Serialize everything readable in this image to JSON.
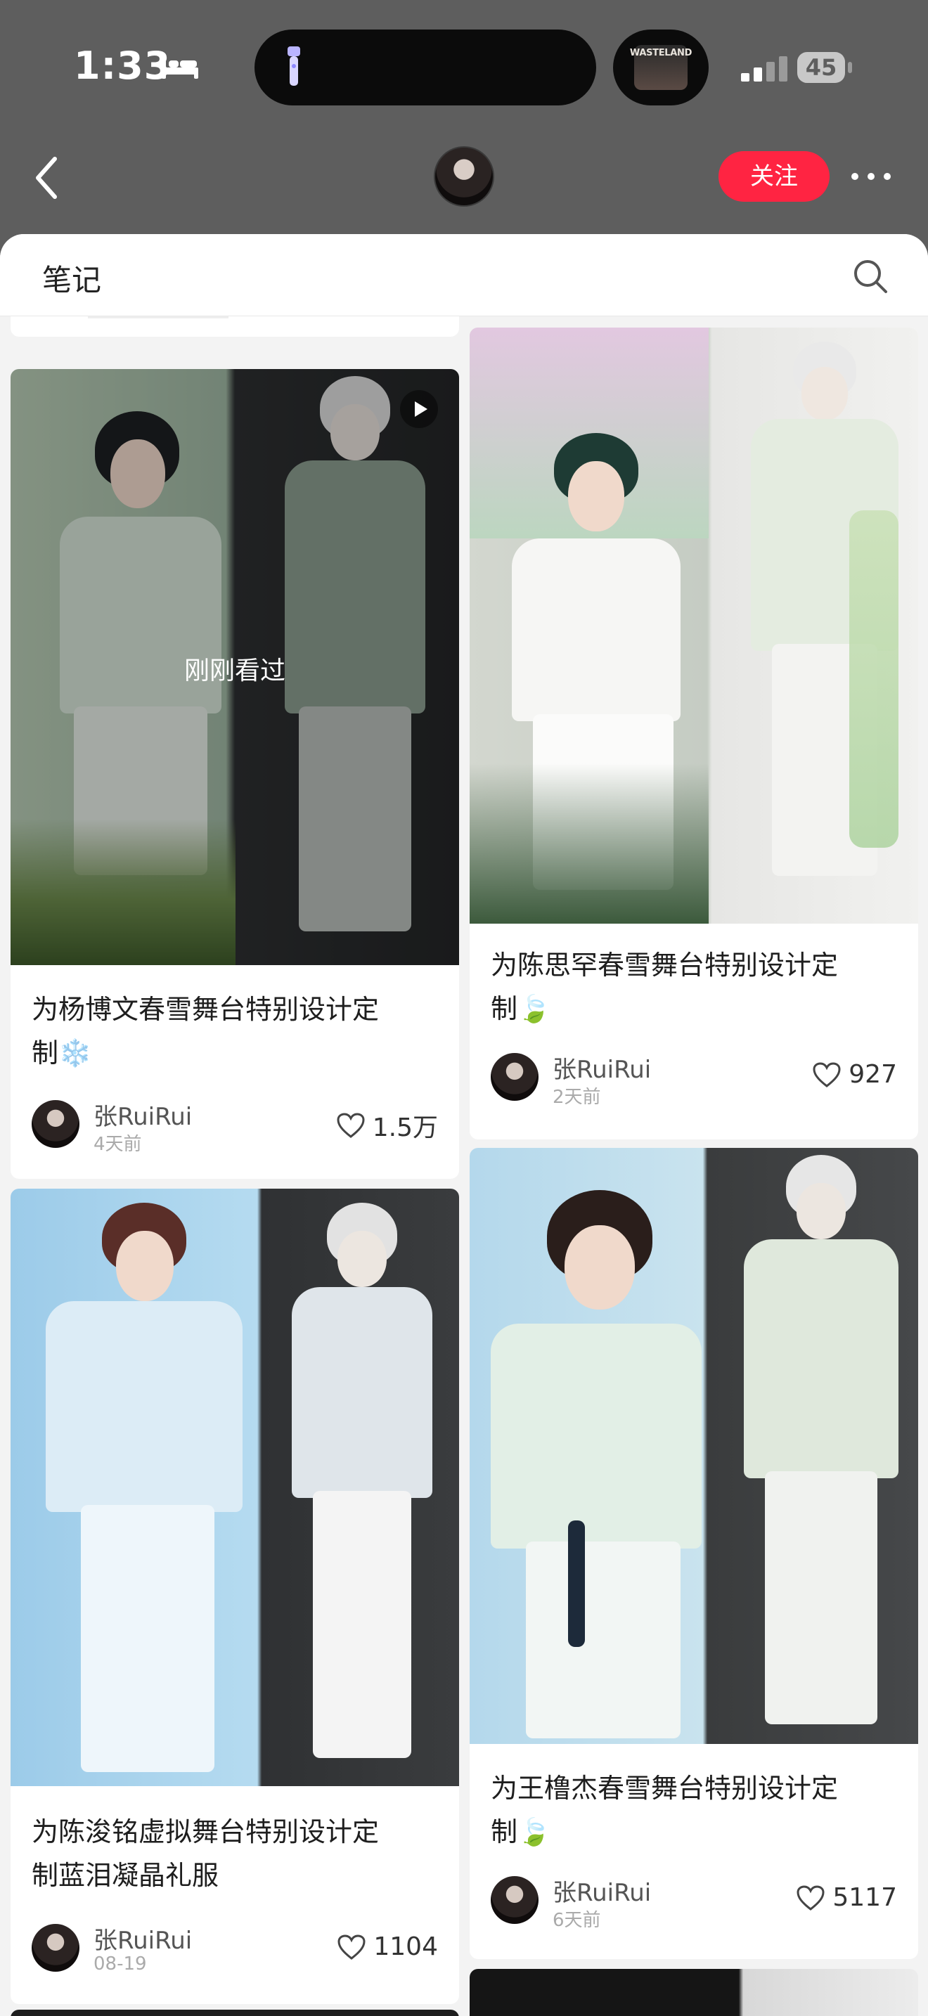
{
  "status_bar": {
    "time": "1:33",
    "battery": "45",
    "island_art_text": "WASTELAND"
  },
  "header": {
    "follow_label": "关注"
  },
  "tab": {
    "title": "笔记"
  },
  "notes": [
    {
      "title_line1": "为杨博文春雪舞台特别设计定",
      "title_line2": "制❄️",
      "author": "张RuiRui",
      "time": "4天前",
      "likes": "1.5万",
      "overlay_label": "刚刚看过",
      "has_video": true
    },
    {
      "title_line1": "为陈思罕春雪舞台特别设计定",
      "title_line2": "制🍃",
      "author": "张RuiRui",
      "time": "2天前",
      "likes": "927"
    },
    {
      "title_line1": "为陈浚铭虚拟舞台特别设计定",
      "title_line2": "制蓝泪凝晶礼服",
      "author": "张RuiRui",
      "time": "08-19",
      "likes": "1104"
    },
    {
      "title_line1": "为王橹杰春雪舞台特别设计定",
      "title_line2": "制🍃",
      "author": "张RuiRui",
      "time": "6天前",
      "likes": "5117"
    }
  ],
  "colors": {
    "accent": "#ff2442",
    "background": "#f3f3f3",
    "header_dim": "#5e5e5e"
  }
}
